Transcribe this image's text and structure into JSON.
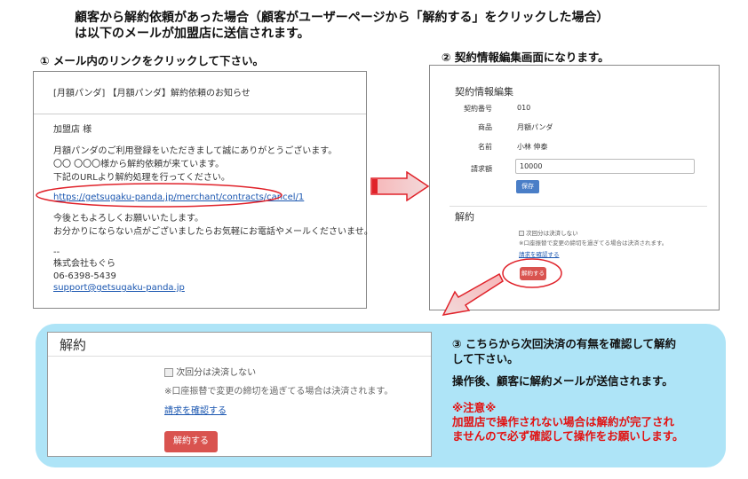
{
  "header": {
    "line1": "顧客から解約依頼があった場合（顧客がユーザーページから「解約する」をクリックした場合）",
    "line2": "は以下のメールが加盟店に送信されます。"
  },
  "step1": {
    "label": "① メール内のリンクをクリックして下さい。"
  },
  "step2": {
    "label": "② 契約情報編集画面になります。"
  },
  "email": {
    "subject": "[月額パンダ] 【月額パンダ】解約依頼のお知らせ",
    "greeting": "加盟店 様",
    "body1": "月額パンダのご利用登録をいただきまして誠にありがとうございます。",
    "body2": "〇〇 〇〇〇様から解約依頼が来ています。",
    "body3": "下記のURLより解約処理を行ってください。",
    "url": "https://getsugaku-panda.jp/merchant/contracts/cancel/1",
    "closing1": "今後ともよろしくお願いいたします。",
    "closing2": "お分かりにならない点がございましたらお気軽にお電話やメールくださいませ。",
    "sig_dash": "--",
    "company": "株式会社もぐら",
    "phone": "06-6398-5439",
    "mail": "support@getsugaku-panda.jp"
  },
  "contract_edit": {
    "title": "契約情報編集",
    "fields": [
      {
        "label": "契約番号",
        "value": "010"
      },
      {
        "label": "商品",
        "value": "月額パンダ"
      },
      {
        "label": "名前",
        "value": "小林 伸泰"
      }
    ],
    "amount_label": "請求額",
    "amount_value": "10000",
    "save_button": "保存",
    "cancel_section": "解約",
    "checkbox_label": "次回分は決済しない",
    "note": "※口座振替で変更の締切を過ぎてる場合は決済されます。",
    "confirm_link": "請求を確認する",
    "cancel_button": "解約する"
  },
  "zoom": {
    "title": "解約",
    "checkbox_label": "次回分は決済しない",
    "note": "※口座振替で変更の締切を過ぎてる場合は決済されます。",
    "confirm_link": "請求を確認する",
    "cancel_button": "解約する"
  },
  "instructions": {
    "step3_line1": "③ こちらから次回決済の有無を確認して解約",
    "step3_line2": "して下さい。",
    "after": "操作後、顧客に解約メールが送信されます。",
    "caution_title": "※注意※",
    "caution_line1": "加盟店で操作されない場合は解約が完了され",
    "caution_line2": "ませんので必ず確認して操作をお願いします。"
  },
  "colors": {
    "callout_bg": "#aee4f7",
    "red_button": "#d9534f",
    "blue_button": "#4a7ec7",
    "arrow_red": "#e0222a",
    "caution_red": "#e21212",
    "link_blue": "#1a56b0"
  }
}
